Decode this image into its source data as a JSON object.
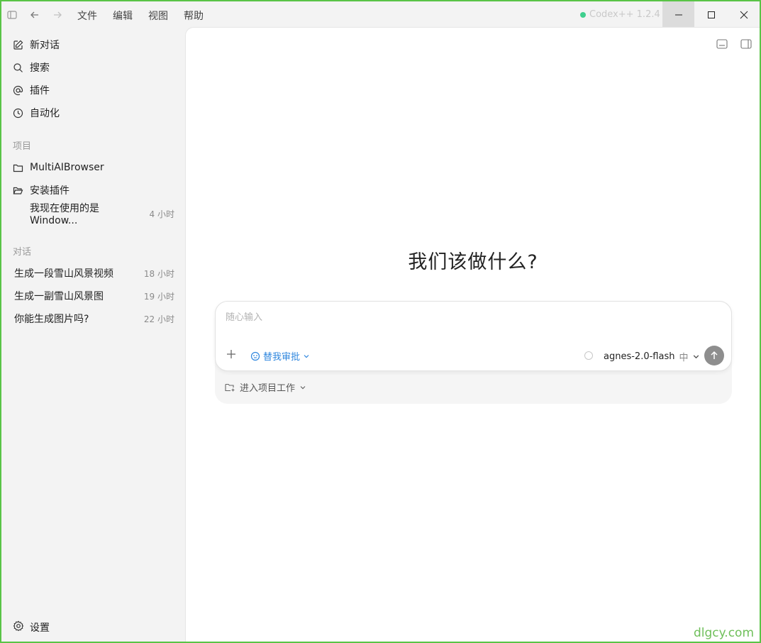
{
  "titlebar": {
    "menu": [
      "文件",
      "编辑",
      "视图",
      "帮助"
    ],
    "app_version": "Codex++ 1.2.4"
  },
  "sidebar": {
    "nav": [
      {
        "label": "新对话",
        "icon": "edit-icon"
      },
      {
        "label": "搜索",
        "icon": "search-icon"
      },
      {
        "label": "插件",
        "icon": "at-icon"
      },
      {
        "label": "自动化",
        "icon": "clock-icon"
      }
    ],
    "projects_heading": "项目",
    "projects": [
      {
        "label": "MultiAIBrowser",
        "icon": "folder-icon"
      },
      {
        "label": "安装插件",
        "icon": "folder-open-icon"
      }
    ],
    "thread": {
      "label": "我现在使用的是 Window...",
      "time": "4 小时"
    },
    "conversations_heading": "对话",
    "conversations": [
      {
        "label": "生成一段雪山风景视频",
        "time": "18 小时"
      },
      {
        "label": "生成一副雪山风景图",
        "time": "19 小时"
      },
      {
        "label": "你能生成图片吗?",
        "time": "22 小时"
      }
    ],
    "settings_label": "设置"
  },
  "main": {
    "heading": "我们该做什么?",
    "composer": {
      "placeholder": "随心输入",
      "approval_label": "替我审批",
      "model": "agnes-2.0-flash",
      "level": "中"
    },
    "project_button": "进入项目工作"
  },
  "watermark": "dlgcy.com",
  "colors": {
    "accent": "#2e86de",
    "status_dot": "#3fcf8e",
    "border": "#59c446"
  }
}
